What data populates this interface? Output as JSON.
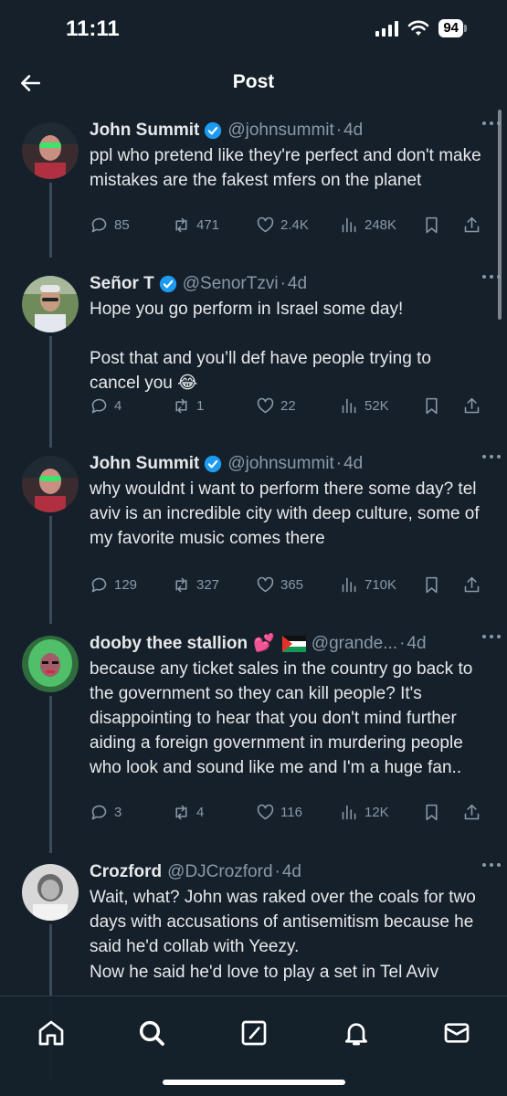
{
  "status_bar": {
    "time": "11:11",
    "battery": "94"
  },
  "header": {
    "title": "Post"
  },
  "tweets": [
    {
      "name": "John Summit",
      "handle": "@johnsummit",
      "time": "4d",
      "text": "ppl who pretend like they're perfect and don't make mistakes are the fakest mfers on the planet",
      "replies": "85",
      "retweets": "471",
      "likes": "2.4K",
      "views": "248K"
    },
    {
      "name": "Señor T",
      "handle": "@SenorTzvi",
      "time": "4d",
      "text_line1": "Hope you go perform in Israel some day!",
      "text_line2": "Post that and you’ll def have people trying to cancel you",
      "emoji": "😂",
      "replies": "4",
      "retweets": "1",
      "likes": "22",
      "views": "52K"
    },
    {
      "name": "John Summit",
      "handle": "@johnsummit",
      "time": "4d",
      "text": "why wouldnt i want to perform there some day? tel aviv is an incredible city with deep culture, some of my favorite music comes there",
      "replies": "129",
      "retweets": "327",
      "likes": "365",
      "views": "710K"
    },
    {
      "name": "dooby thee stallion",
      "name_emoji": "💕",
      "handle": "@grande...",
      "time": "4d",
      "text": "because any ticket sales in the country go back to the government so they can kill people? It's disappointing to hear that you don't mind further aiding a foreign government in murdering people who look and sound like me and I'm a huge fan..",
      "replies": "3",
      "retweets": "4",
      "likes": "116",
      "views": "12K"
    },
    {
      "name": "Crozford",
      "handle": "@DJCrozford",
      "time": "4d",
      "text": "Wait, what? John was raked over the coals for two days with accusations of antisemitism because he said he'd collab with Yeezy.",
      "text_cut": "Now he said he'd love to play a set in Tel Aviv"
    }
  ],
  "separator": "·",
  "colors": {
    "background": "#15202b",
    "verified": "#1d9bf0",
    "secondary_text": "#8b98a5",
    "thread_line": "#3b4a56"
  },
  "nav": [
    "home-icon",
    "search-icon",
    "compose-icon",
    "notifications-icon",
    "messages-icon"
  ]
}
